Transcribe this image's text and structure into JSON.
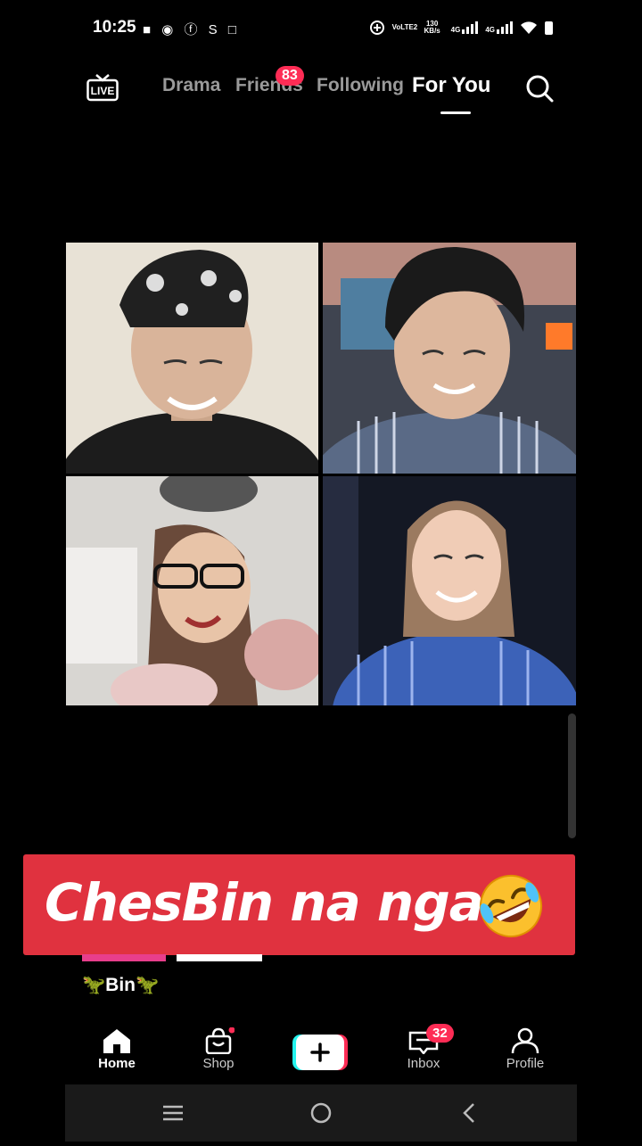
{
  "status_bar": {
    "time": "10:25",
    "left_icons": "■ ◉ ⓕ S □",
    "lte": "VoLTE2",
    "speed": "130 KB/s",
    "net1": "4G",
    "net2": "4G"
  },
  "top_nav": {
    "live_label": "LIVE",
    "tabs": [
      {
        "label": "Drama"
      },
      {
        "label": "Friends",
        "badge": "83"
      },
      {
        "label": "Following"
      },
      {
        "label": "For You"
      }
    ]
  },
  "banner": {
    "text": "ChesBin na nga",
    "emoji": "rolling-on-the-floor-laughing"
  },
  "username": "🦖Bin🦖",
  "bottom_nav": {
    "items": [
      {
        "label": "Home"
      },
      {
        "label": "Shop"
      },
      {
        "label": "Inbox",
        "badge": "32"
      },
      {
        "label": "Profile"
      }
    ]
  },
  "colors": {
    "accent": "#fe2c55",
    "banner": "#e0323f",
    "cyan": "#25f4ee"
  }
}
